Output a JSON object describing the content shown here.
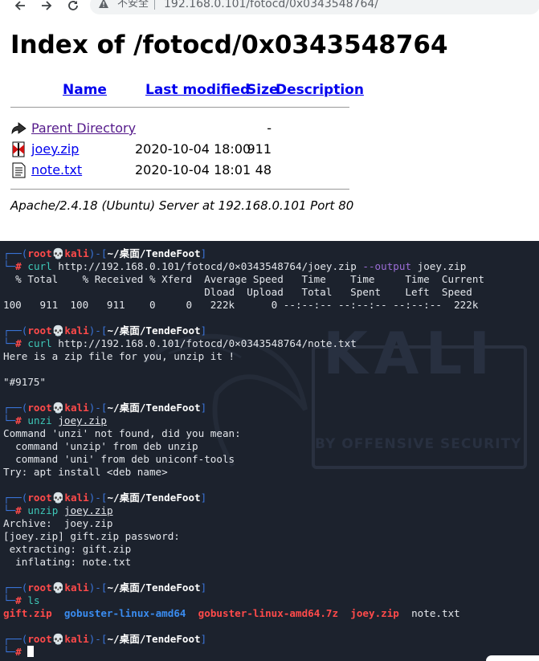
{
  "browser": {
    "security_label": "不安全",
    "url": "192.168.0.101/fotocd/0x0343548764/"
  },
  "listing": {
    "title": "Index of /fotocd/0x0343548764",
    "headers": {
      "name": "Name",
      "last_modified": "Last modified",
      "size": "Size",
      "description": "Description"
    },
    "rows": [
      {
        "icon": "back-icon",
        "name": "Parent Directory",
        "date": "",
        "size": "-"
      },
      {
        "icon": "zip-icon",
        "name": "joey.zip",
        "date": "2020-10-04 18:00",
        "size": "911"
      },
      {
        "icon": "text-file-icon",
        "name": "note.txt",
        "date": "2020-10-04 18:01",
        "size": "48"
      }
    ],
    "address": "Apache/2.4.18 (Ubuntu) Server at 192.168.0.101 Port 80"
  },
  "terminal": {
    "prompt": {
      "open": "┌──(",
      "user": "root",
      "skull": "💀",
      "host": "kali",
      "mid": ")-[",
      "path": "~/桌面/TendeFoot",
      "close": "]",
      "lead": "└─",
      "hash": "#"
    },
    "blocks": [
      {
        "cmd": "curl",
        "args": " http://192.168.0.101/fotocd/0×0343548764/joey.zip ",
        "opt": "--output",
        "args2": " joey.zip",
        "output": [
          "  % Total    % Received % Xferd  Average Speed   Time    Time     Time  Current",
          "                                 Dload  Upload   Total   Spent    Left  Speed",
          "100   911  100   911    0     0   222k      0 --:--:-- --:--:-- --:--:--  222k"
        ]
      },
      {
        "cmd": "curl",
        "args": " http://192.168.0.101/fotocd/0×0343548764/note.txt",
        "output": [
          "Here is a zip file for you, unzip it !",
          "",
          "\"#9175\""
        ]
      },
      {
        "cmd": "unzi",
        "arg_ul": "joey.zip",
        "output": [
          "Command 'unzi' not found, did you mean:",
          "  command 'unzip' from deb unzip",
          "  command 'uni' from deb uniconf-tools",
          "Try: apt install <deb name>"
        ]
      },
      {
        "cmd": "unzip",
        "arg_ul": "joey.zip",
        "output": [
          "Archive:  joey.zip",
          "[joey.zip] gift.zip password:",
          " extracting: gift.zip",
          "  inflating: note.txt"
        ]
      },
      {
        "cmd": "ls",
        "files": [
          {
            "name": "gift.zip",
            "color": "#ff4a4a"
          },
          {
            "name": "gobuster-linux-amd64",
            "color": "#3a8cf0"
          },
          {
            "name": "gobuster-linux-amd64.7z",
            "color": "#ff4a4a"
          },
          {
            "name": "joey.zip",
            "color": "#ff4a4a"
          },
          {
            "name": "note.txt",
            "color": "#e4e7ec"
          }
        ]
      }
    ],
    "watermark": {
      "word": "KALI",
      "sub": "BY OFFENSIVE SECURITY"
    }
  }
}
